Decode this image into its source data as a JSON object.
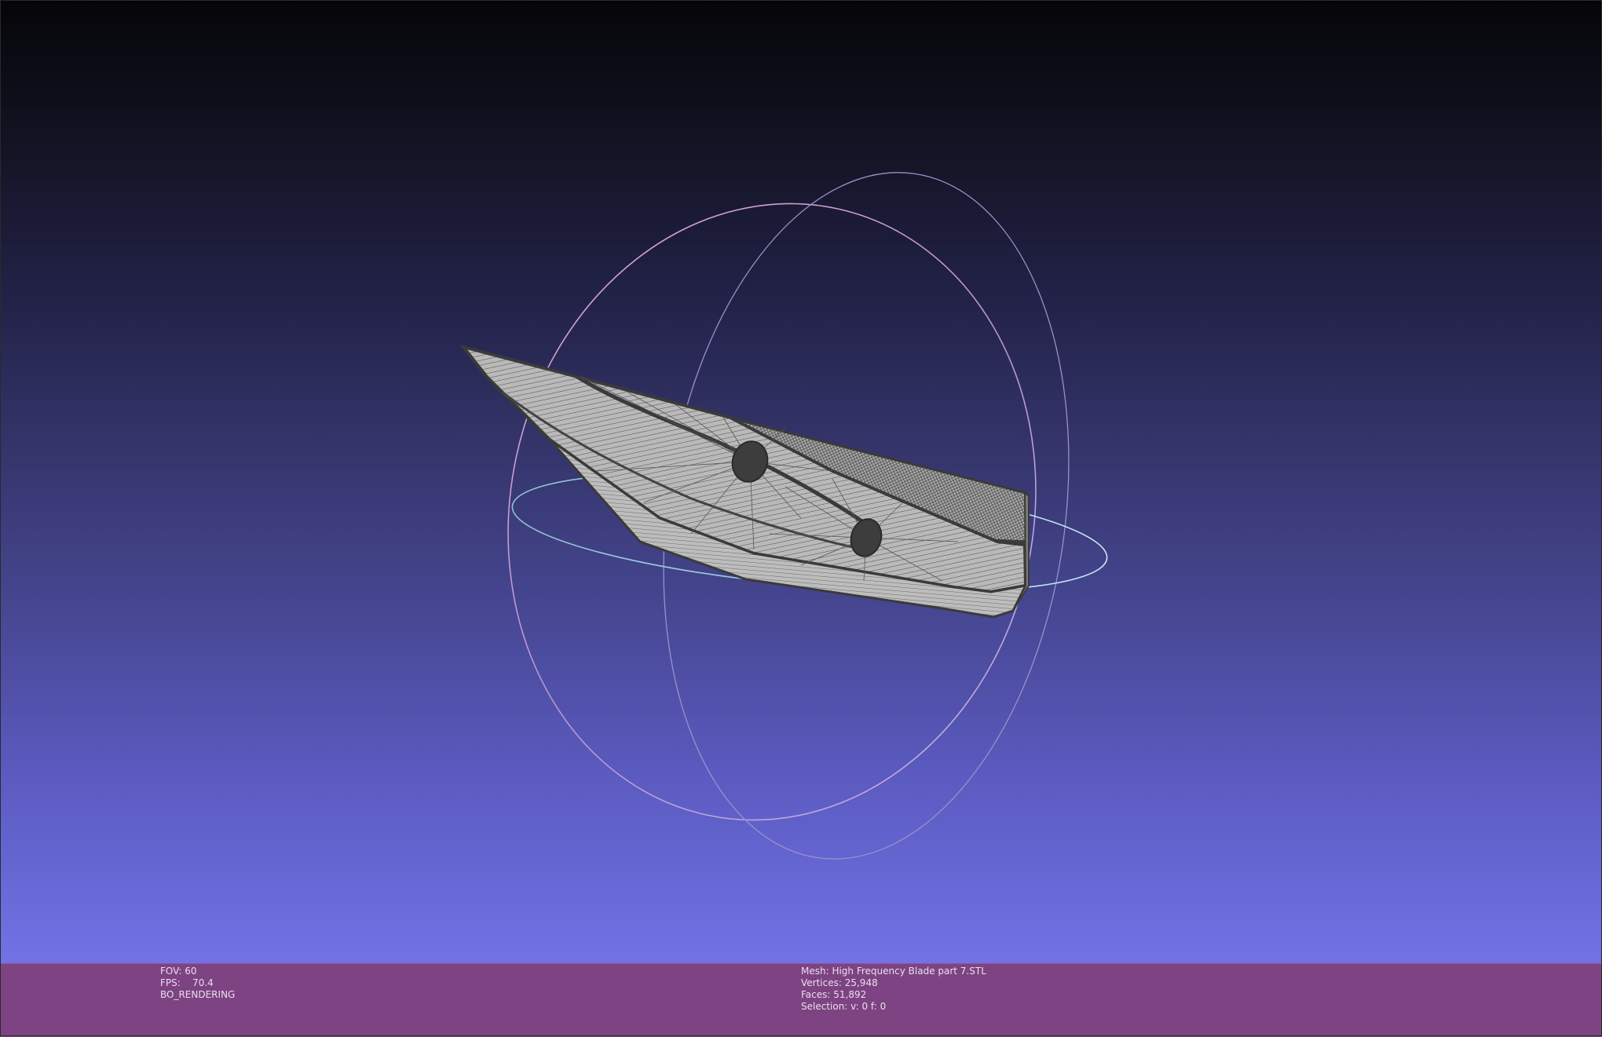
{
  "viewer": {
    "background_top": "#050508",
    "background_bottom": "#7272e6",
    "infobar_color": "#7e4382",
    "mesh_color": "#b4b4b4",
    "mesh_edge_color": "#3c3c3c"
  },
  "info_left": {
    "fov": "FOV: 60",
    "fps": "FPS:    70.4",
    "render_mode": "BO_RENDERING"
  },
  "info_right": {
    "mesh": "Mesh: High Frequency Blade part 7.STL",
    "vertices": "Vertices: 25,948",
    "faces": "Faces: 51,892",
    "selection": "Selection: v: 0 f: 0"
  },
  "trackball": {
    "icon": "trackball-gizmo-icon"
  }
}
